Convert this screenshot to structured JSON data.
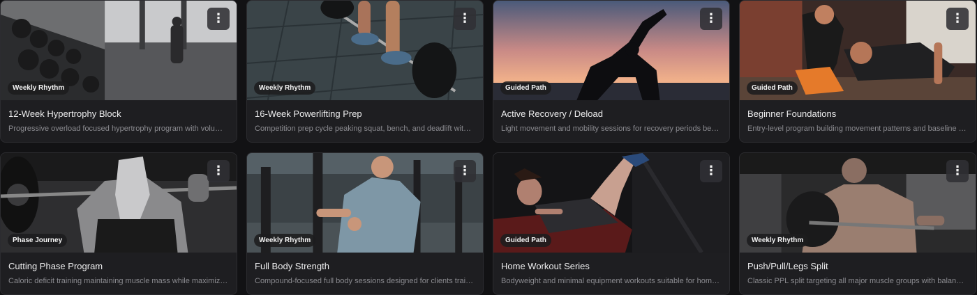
{
  "programs": [
    {
      "title": "12-Week Hypertrophy Block",
      "description": "Progressive overload focused hypertrophy program with volume accumulation phases",
      "badge": "Weekly Rhythm",
      "thumbnail_icon": "dumbbell-rack-photo"
    },
    {
      "title": "16-Week Powerlifting Prep",
      "description": "Competition prep cycle peaking squat, bench, and deadlift with structured blocks",
      "badge": "Weekly Rhythm",
      "thumbnail_icon": "deadlift-photo"
    },
    {
      "title": "Active Recovery / Deload",
      "description": "Light movement and mobility sessions for recovery periods between blocks",
      "badge": "Guided Path",
      "thumbnail_icon": "sunset-stretch-photo"
    },
    {
      "title": "Beginner Foundations",
      "description": "Entry-level program building movement patterns and baseline strength",
      "badge": "Guided Path",
      "thumbnail_icon": "coached-pushup-photo"
    },
    {
      "title": "Cutting Phase Program",
      "description": "Caloric deficit training maintaining muscle mass while maximizing fat loss",
      "badge": "Phase Journey",
      "thumbnail_icon": "barbell-squat-photo"
    },
    {
      "title": "Full Body Strength",
      "description": "Compound-focused full body sessions designed for clients training three days",
      "badge": "Weekly Rhythm",
      "thumbnail_icon": "machine-row-photo"
    },
    {
      "title": "Home Workout Series",
      "description": "Bodyweight and minimal equipment workouts suitable for home training",
      "badge": "Guided Path",
      "thumbnail_icon": "leg-press-photo"
    },
    {
      "title": "Push/Pull/Legs Split",
      "description": "Classic PPL split targeting all major muscle groups with balanced volume",
      "badge": "Weekly Rhythm",
      "thumbnail_icon": "barbell-curl-photo"
    }
  ],
  "menu_glyph": "⋮",
  "colors": {
    "card": "#1e1e21",
    "page": "#121214",
    "badge_bg": "#1c1c1e"
  }
}
